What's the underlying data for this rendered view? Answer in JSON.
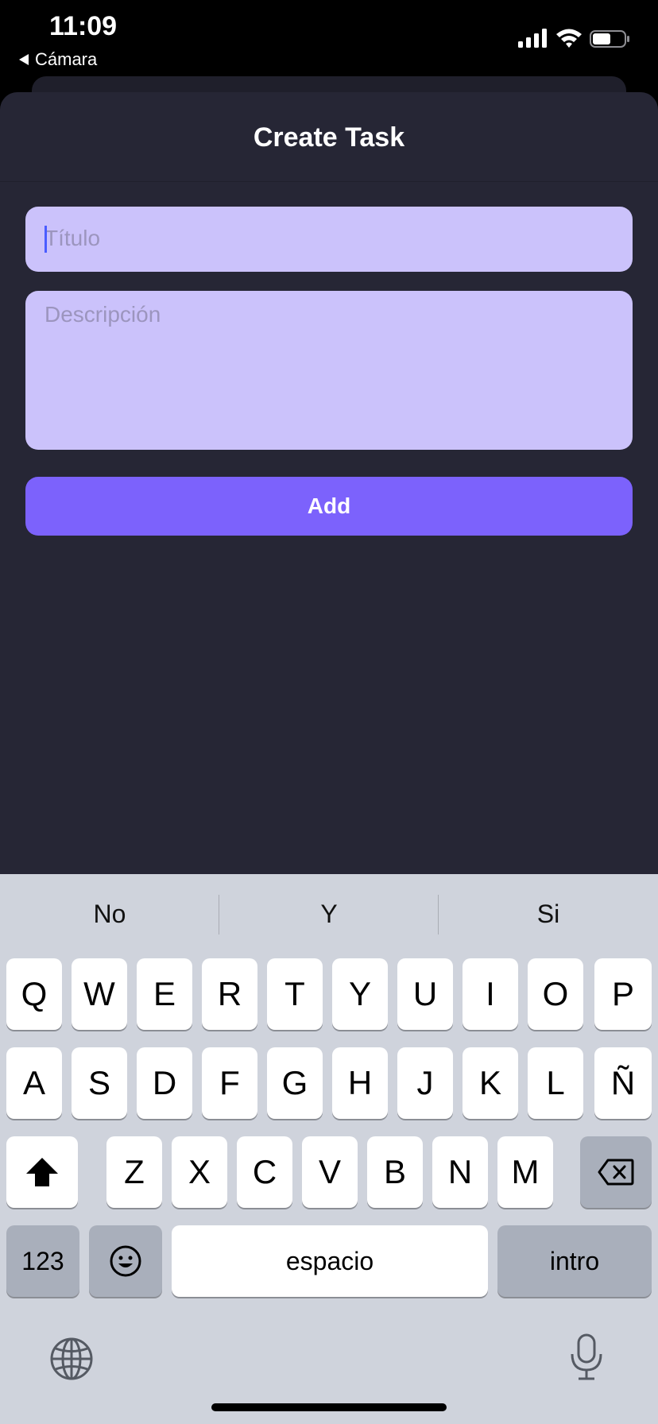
{
  "status_bar": {
    "time": "11:09",
    "back_label": "Cámara"
  },
  "sheet": {
    "title": "Create Task"
  },
  "form": {
    "title_placeholder": "Título",
    "description_placeholder": "Descripción",
    "add_label": "Add"
  },
  "keyboard": {
    "suggestions": [
      "No",
      "Y",
      "Si"
    ],
    "row1": [
      "Q",
      "W",
      "E",
      "R",
      "T",
      "Y",
      "U",
      "I",
      "O",
      "P"
    ],
    "row2": [
      "A",
      "S",
      "D",
      "F",
      "G",
      "H",
      "J",
      "K",
      "L",
      "Ñ"
    ],
    "row3": [
      "Z",
      "X",
      "C",
      "V",
      "B",
      "N",
      "M"
    ],
    "numbers_label": "123",
    "space_label": "espacio",
    "return_label": "intro"
  },
  "colors": {
    "sheet_bg": "#262635",
    "field_bg": "#cbc2fb",
    "accent": "#7c62fc",
    "keyboard_bg": "#cfd3dc"
  },
  "icons": [
    "back-triangle-icon",
    "signal-icon",
    "wifi-icon",
    "battery-icon",
    "shift-icon",
    "delete-icon",
    "emoji-icon",
    "globe-icon",
    "microphone-icon"
  ]
}
